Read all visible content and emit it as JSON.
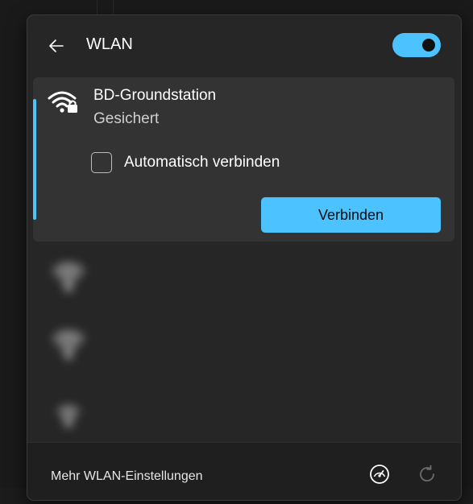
{
  "header": {
    "back_icon": "arrow-left-icon",
    "title": "WLAN",
    "toggle_state": "on"
  },
  "selected_network": {
    "name": "BD-Groundstation",
    "status": "Gesichert",
    "icon": "wifi-lock-icon",
    "auto_connect_label": "Automatisch verbinden",
    "auto_connect_checked": false,
    "connect_label": "Verbinden"
  },
  "other_networks": [
    {
      "name": "",
      "icon": "wifi-icon"
    },
    {
      "name": "",
      "icon": "wifi-icon"
    },
    {
      "name": "",
      "icon": "wifi-icon"
    }
  ],
  "footer": {
    "link_label": "Mehr WLAN-Einstellungen",
    "speedometer_icon": "speedometer-icon",
    "refresh_icon": "refresh-icon"
  },
  "colors": {
    "accent": "#4cc2ff",
    "panel": "#262626",
    "card": "#333333",
    "footer": "#1f1f1f"
  }
}
